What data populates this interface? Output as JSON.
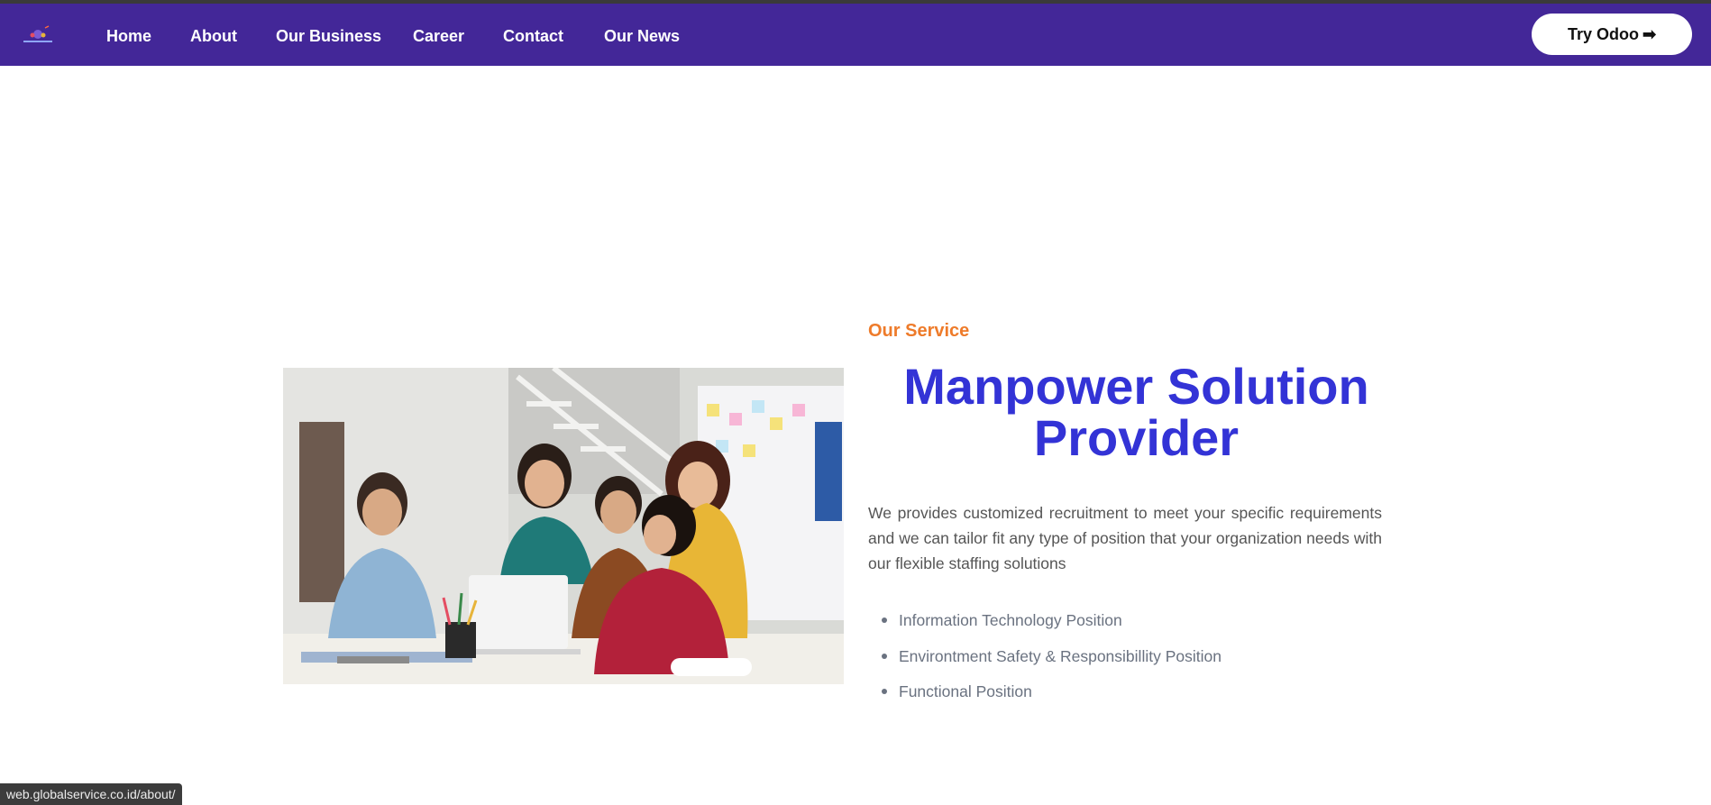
{
  "navbar": {
    "bg": "#432798",
    "items": [
      {
        "label": "Home"
      },
      {
        "label": "About"
      },
      {
        "label": "Our Business"
      },
      {
        "label": "Career"
      },
      {
        "label": "Contact"
      },
      {
        "label": "Our News"
      }
    ],
    "cta_label": "Try Odoo",
    "cta_icon": "arrow-right-icon"
  },
  "section": {
    "eyebrow": "Our Service",
    "title": "Manpower Solution Provider",
    "description": "We provides customized recruitment to meet your specific requirements and we can tailor fit any type of position that your organization needs with our flexible staffing solutions",
    "positions": [
      "Information  Technology Position",
      "Environtment Safety & Responsibillity Position",
      "Functional Position"
    ]
  },
  "colors": {
    "eyebrow": "#ee7b2a",
    "title": "#3333d6"
  },
  "statusbar": {
    "url": "web.globalservice.co.id/about/"
  }
}
